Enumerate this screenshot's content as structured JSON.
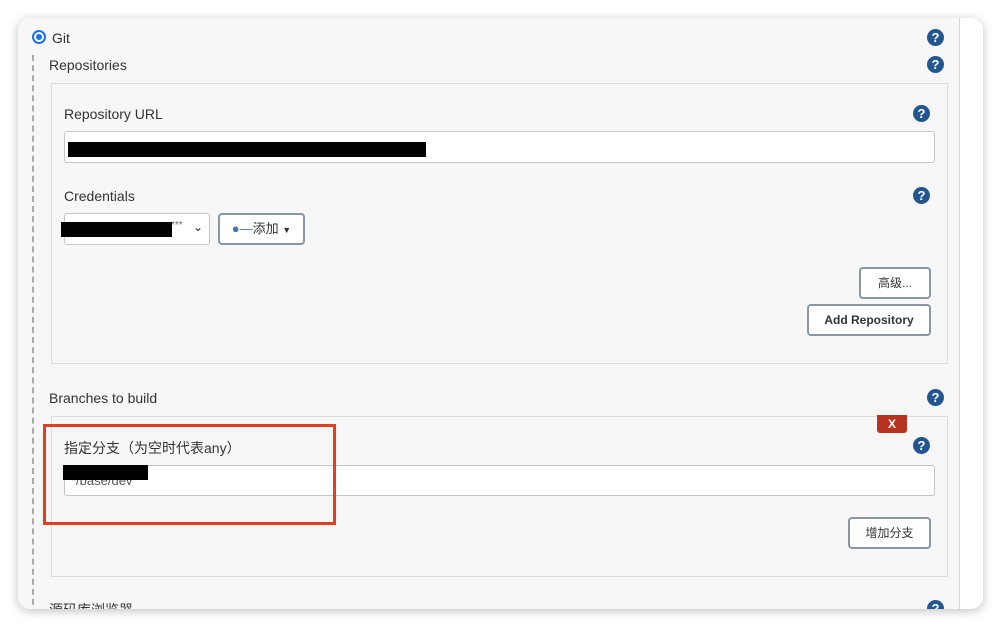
{
  "scm_option": {
    "label": "Git",
    "selected": true
  },
  "repositories": {
    "label": "Repositories",
    "repository_url": {
      "label": "Repository URL",
      "value": ""
    },
    "credentials": {
      "label": "Credentials",
      "selected": "***",
      "add_label": "添加"
    },
    "advanced_label": "高级...",
    "add_repository_label": "Add Repository"
  },
  "branches": {
    "label": "Branches to build",
    "delete_label": "X",
    "branch_specifier": {
      "label": "指定分支（为空时代表any）",
      "value": "*/base/dev"
    },
    "add_branch_label": "增加分支"
  },
  "next_section_label": "源码库浏览器",
  "help_symbol": "?",
  "colors": {
    "help": "#23568f",
    "delete": "#b5331f",
    "highlight": "#e0401e",
    "radio": "#1a73e8"
  }
}
